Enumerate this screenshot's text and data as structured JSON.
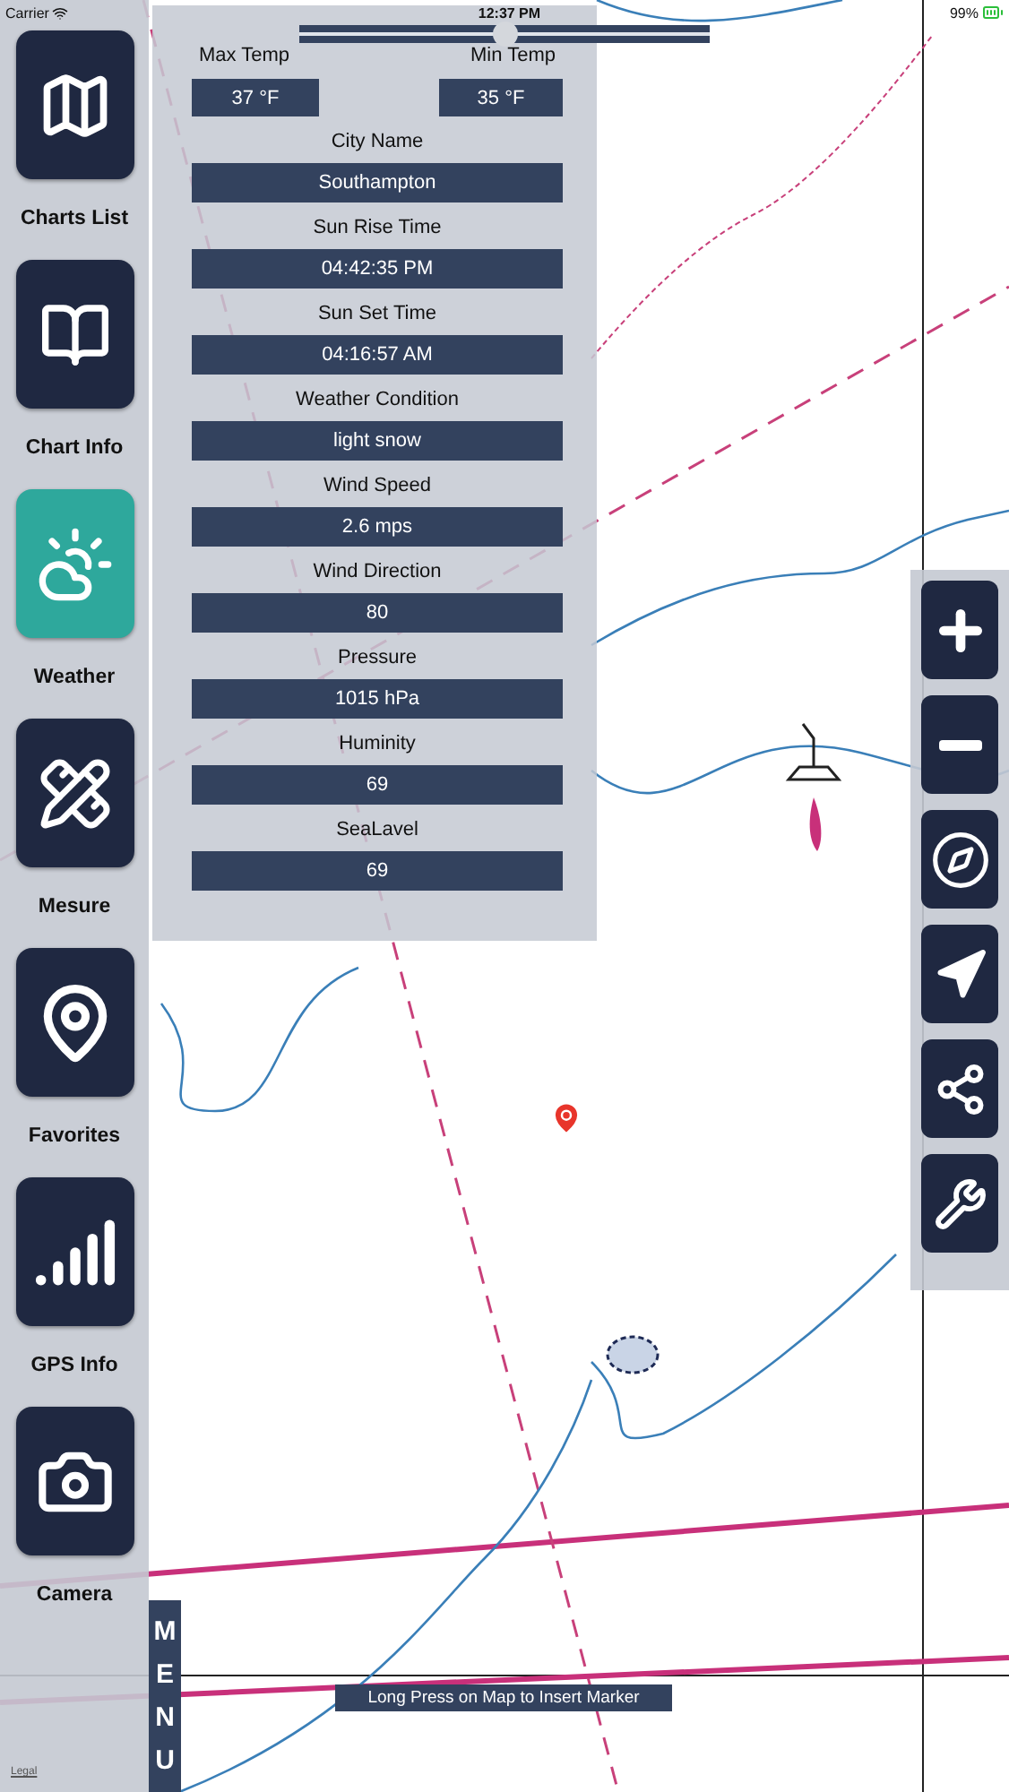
{
  "status_bar": {
    "carrier": "Carrier",
    "time": "12:37 PM",
    "battery": "99%"
  },
  "sidebar": {
    "items": [
      {
        "kind": "charts",
        "label": "Charts List",
        "selected": false
      },
      {
        "kind": "chart_info",
        "label": "Chart Info",
        "selected": false
      },
      {
        "kind": "weather",
        "label": "Weather",
        "selected": true
      },
      {
        "kind": "measure",
        "label": "Mesure",
        "selected": false
      },
      {
        "kind": "favorites",
        "label": "Favorites",
        "selected": false
      },
      {
        "kind": "gps",
        "label": "GPS Info",
        "selected": false
      },
      {
        "kind": "camera",
        "label": "Camera",
        "selected": false
      }
    ]
  },
  "weather_panel": {
    "max_temp": {
      "label": "Max Temp",
      "value": "37 °F"
    },
    "min_temp": {
      "label": "Min Temp",
      "value": "35 °F"
    },
    "slider": {
      "level": 0.5
    },
    "fields": [
      {
        "label": "City Name",
        "value": "Southampton"
      },
      {
        "label": "Sun Rise Time",
        "value": "04:42:35 PM"
      },
      {
        "label": "Sun Set Time",
        "value": "04:16:57 AM"
      },
      {
        "label": "Weather Condition",
        "value": "light snow"
      },
      {
        "label": "Wind Speed",
        "value": "2.6 mps"
      },
      {
        "label": "Wind Direction",
        "value": "80"
      },
      {
        "label": "Pressure",
        "value": "1015 hPa"
      },
      {
        "label": "Huminity",
        "value": "69"
      },
      {
        "label": "SeaLavel",
        "value": "69"
      }
    ]
  },
  "map_tools": [
    {
      "kind": "zoom_in"
    },
    {
      "kind": "zoom_out"
    },
    {
      "kind": "compass"
    },
    {
      "kind": "locate"
    },
    {
      "kind": "share"
    },
    {
      "kind": "settings"
    }
  ],
  "menu_tab": {
    "label": "MENU"
  },
  "hint": "Long Press on Map to Insert Marker",
  "legal": "Legal"
}
